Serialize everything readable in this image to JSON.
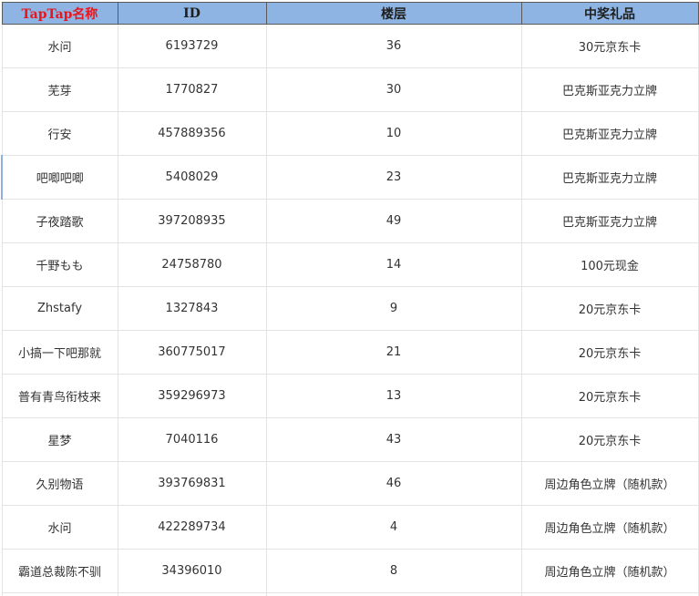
{
  "headers": {
    "name": "TapTap名称",
    "id": "ID",
    "floor": "楼层",
    "prize": "中奖礼品"
  },
  "rows": [
    {
      "name": "水问",
      "id": "6193729",
      "floor": "36",
      "prize": "30元京东卡"
    },
    {
      "name": "芜芽",
      "id": "1770827",
      "floor": "30",
      "prize": "巴克斯亚克力立牌"
    },
    {
      "name": "行安",
      "id": "457889356",
      "floor": "10",
      "prize": "巴克斯亚克力立牌"
    },
    {
      "name": "吧唧吧唧",
      "id": "5408029",
      "floor": "23",
      "prize": "巴克斯亚克力立牌"
    },
    {
      "name": "子夜踏歌",
      "id": "397208935",
      "floor": "49",
      "prize": "巴克斯亚克力立牌"
    },
    {
      "name": "千野もも",
      "id": "24758780",
      "floor": "14",
      "prize": "100元现金"
    },
    {
      "name": "Zhstafy",
      "id": "1327843",
      "floor": "9",
      "prize": "20元京东卡"
    },
    {
      "name": "小搞一下吧那就",
      "id": "360775017",
      "floor": "21",
      "prize": "20元京东卡"
    },
    {
      "name": "普有青鸟衔枝来",
      "id": "359296973",
      "floor": "13",
      "prize": "20元京东卡"
    },
    {
      "name": "星梦",
      "id": "7040116",
      "floor": "43",
      "prize": "20元京东卡"
    },
    {
      "name": "久别物语",
      "id": "393769831",
      "floor": "46",
      "prize": "周边角色立牌（随机款）"
    },
    {
      "name": "水问",
      "id": "422289734",
      "floor": "4",
      "prize": "周边角色立牌（随机款）"
    },
    {
      "name": "霸道总裁陈不驯",
      "id": "34396010",
      "floor": "8",
      "prize": "周边角色立牌（随机款）"
    }
  ],
  "colors": {
    "header_background": "#8db4e2",
    "header_name_text": "#e8161e",
    "grid_line": "#e3e3e3",
    "selection_marker": "#8fb0dd"
  }
}
